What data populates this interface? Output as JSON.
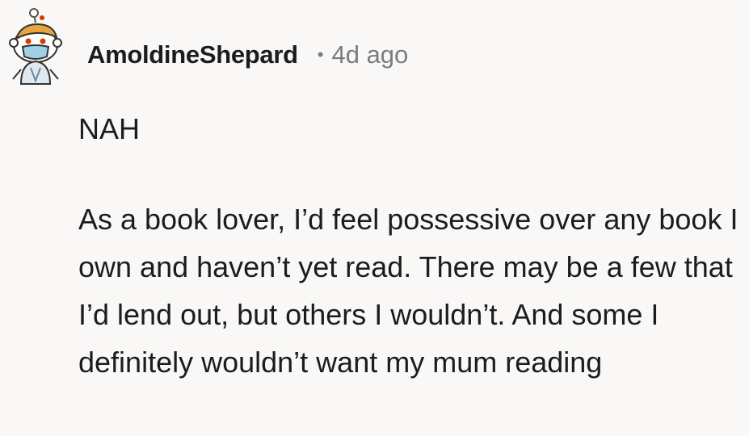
{
  "comment": {
    "author": "AmoldineShepard",
    "separator": "•",
    "timestamp": "4d ago",
    "avatar_icon": "snoo-avatar-icon",
    "paragraphs": [
      "NAH",
      "As a book lover, I’d feel possessive over any book I own and haven’t yet read. There may be a few that I’d lend out, but others I wouldn’t. And some I definitely wouldn’t want my mum reading"
    ]
  }
}
